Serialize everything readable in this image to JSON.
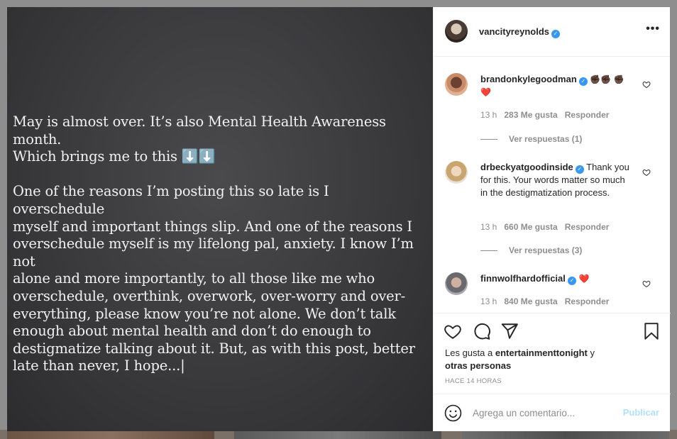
{
  "post": {
    "paragraph1": "May is almost over. It’s also Mental Health Awareness month.\nWhich brings me to this ⬇️⬇️",
    "paragraph2": "One of the reasons I’m posting this so late is I overschedule\nmyself and important things slip. And one of the reasons I\noverschedule myself is my lifelong pal, anxiety. I know I’m not\nalone and more importantly, to all those like me who\noverschedule, overthink, overwork, over-worry and over-\neverything, please know you’re not alone. We don’t talk\nenough about mental health and don’t do enough to\ndestigmatize talking about it. But, as with this post, better\nlate than never, I hope...|"
  },
  "header": {
    "username": "vancityreynolds",
    "verified_mark": "✓",
    "more_icon": "more-dots-icon",
    "more_glyph": "•••"
  },
  "comments": [
    {
      "username": "brandonkylegoodman",
      "text": "✊🏿✊🏿 ✊🏿❤️",
      "age": "13 h",
      "likes": "283 Me gusta",
      "reply": "Responder",
      "view_replies": "Ver respuestas (1)"
    },
    {
      "username": "drbeckyatgoodinside",
      "text": "Thank you for this. Your words matter so much in the destigmatization process.",
      "age": "13 h",
      "likes": "660 Me gusta",
      "reply": "Responder",
      "view_replies": "Ver respuestas (3)"
    },
    {
      "username": "finnwolfhardofficial",
      "text": "❤️",
      "age": "13 h",
      "likes": "840 Me gusta",
      "reply": "Responder"
    }
  ],
  "actions": {
    "like_icon": "heart-icon",
    "comment_icon": "comment-icon",
    "share_icon": "send-icon",
    "save_icon": "bookmark-icon",
    "likes_prefix": "Les gusta a",
    "likes_user": "entertainmenttonight",
    "likes_suffix": " y",
    "likes_others": "otras personas",
    "time_ago": "HACE 14 HORAS"
  },
  "add_comment": {
    "placeholder": "Agrega un comentario...",
    "publish_label": "Publicar",
    "emoji_icon": "smiley-icon"
  },
  "colors": {
    "verified": "#3897f0",
    "text": "#262626",
    "muted": "#8e8e8e",
    "publish_disabled": "#b2dffc",
    "heart_red": "#ed4956"
  }
}
